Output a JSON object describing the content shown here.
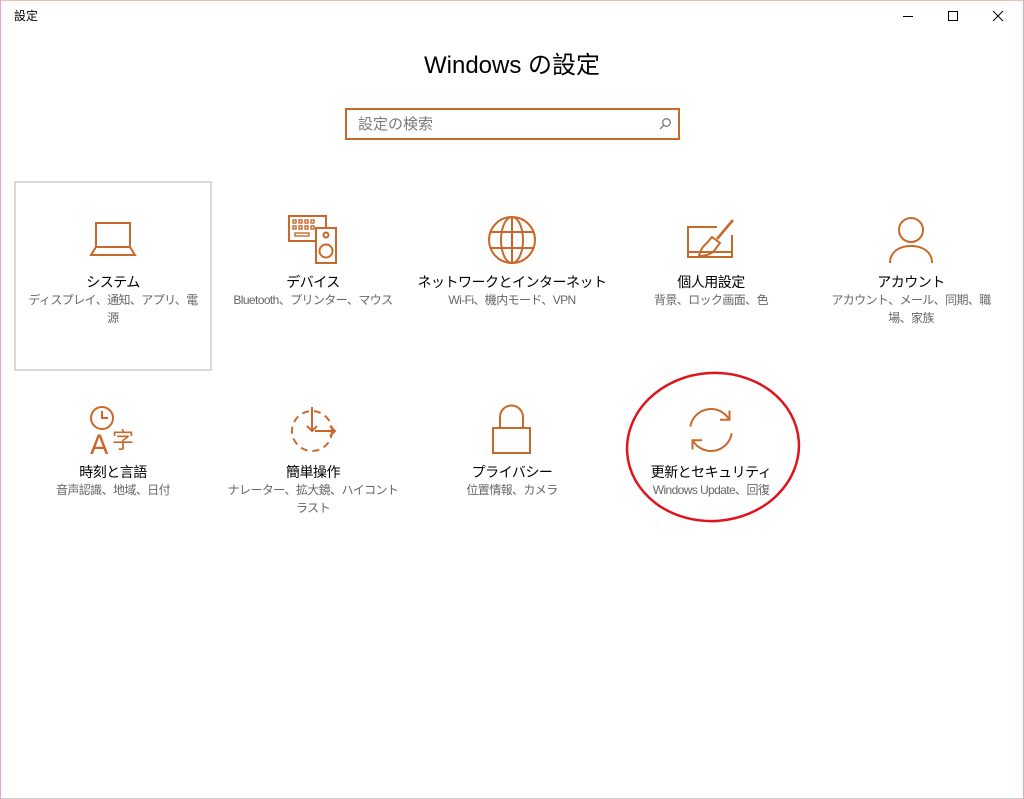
{
  "window": {
    "title": "設定",
    "icons": {
      "minimize": "minimize-icon",
      "maximize": "maximize-icon",
      "close": "close-icon"
    }
  },
  "header": {
    "title": "Windows の設定"
  },
  "search": {
    "placeholder": "設定の検索",
    "icon": "search-icon"
  },
  "colors": {
    "accent": "#c8692b",
    "tile_focus_border": "#d9d9d9",
    "description_text": "#666666",
    "annotation": "#e0141c"
  },
  "focused_tile_index": 0,
  "annotated_tile_index": 8,
  "tiles": [
    {
      "label": "システム",
      "description": "ディスプレイ、通知、アプリ、電源",
      "icon": "laptop-icon"
    },
    {
      "label": "デバイス",
      "description": "Bluetooth、プリンター、マウス",
      "icon": "devices-icon"
    },
    {
      "label": "ネットワークとインターネット",
      "description": "Wi-Fi、機内モード、VPN",
      "icon": "globe-icon"
    },
    {
      "label": "個人用設定",
      "description": "背景、ロック画面、色",
      "icon": "personalization-icon"
    },
    {
      "label": "アカウント",
      "description": "アカウント、メール、同期、職場、家族",
      "icon": "person-icon"
    },
    {
      "label": "時刻と言語",
      "description": "音声認識、地域、日付",
      "icon": "time-language-icon",
      "icon_letters": {
        "latin": "A",
        "kanji": "字"
      }
    },
    {
      "label": "簡単操作",
      "description": "ナレーター、拡大鏡、ハイコントラスト",
      "icon": "ease-of-access-icon"
    },
    {
      "label": "プライバシー",
      "description": "位置情報、カメラ",
      "icon": "lock-icon"
    },
    {
      "label": "更新とセキュリティ",
      "description": "Windows Update、回復",
      "icon": "sync-icon"
    }
  ]
}
